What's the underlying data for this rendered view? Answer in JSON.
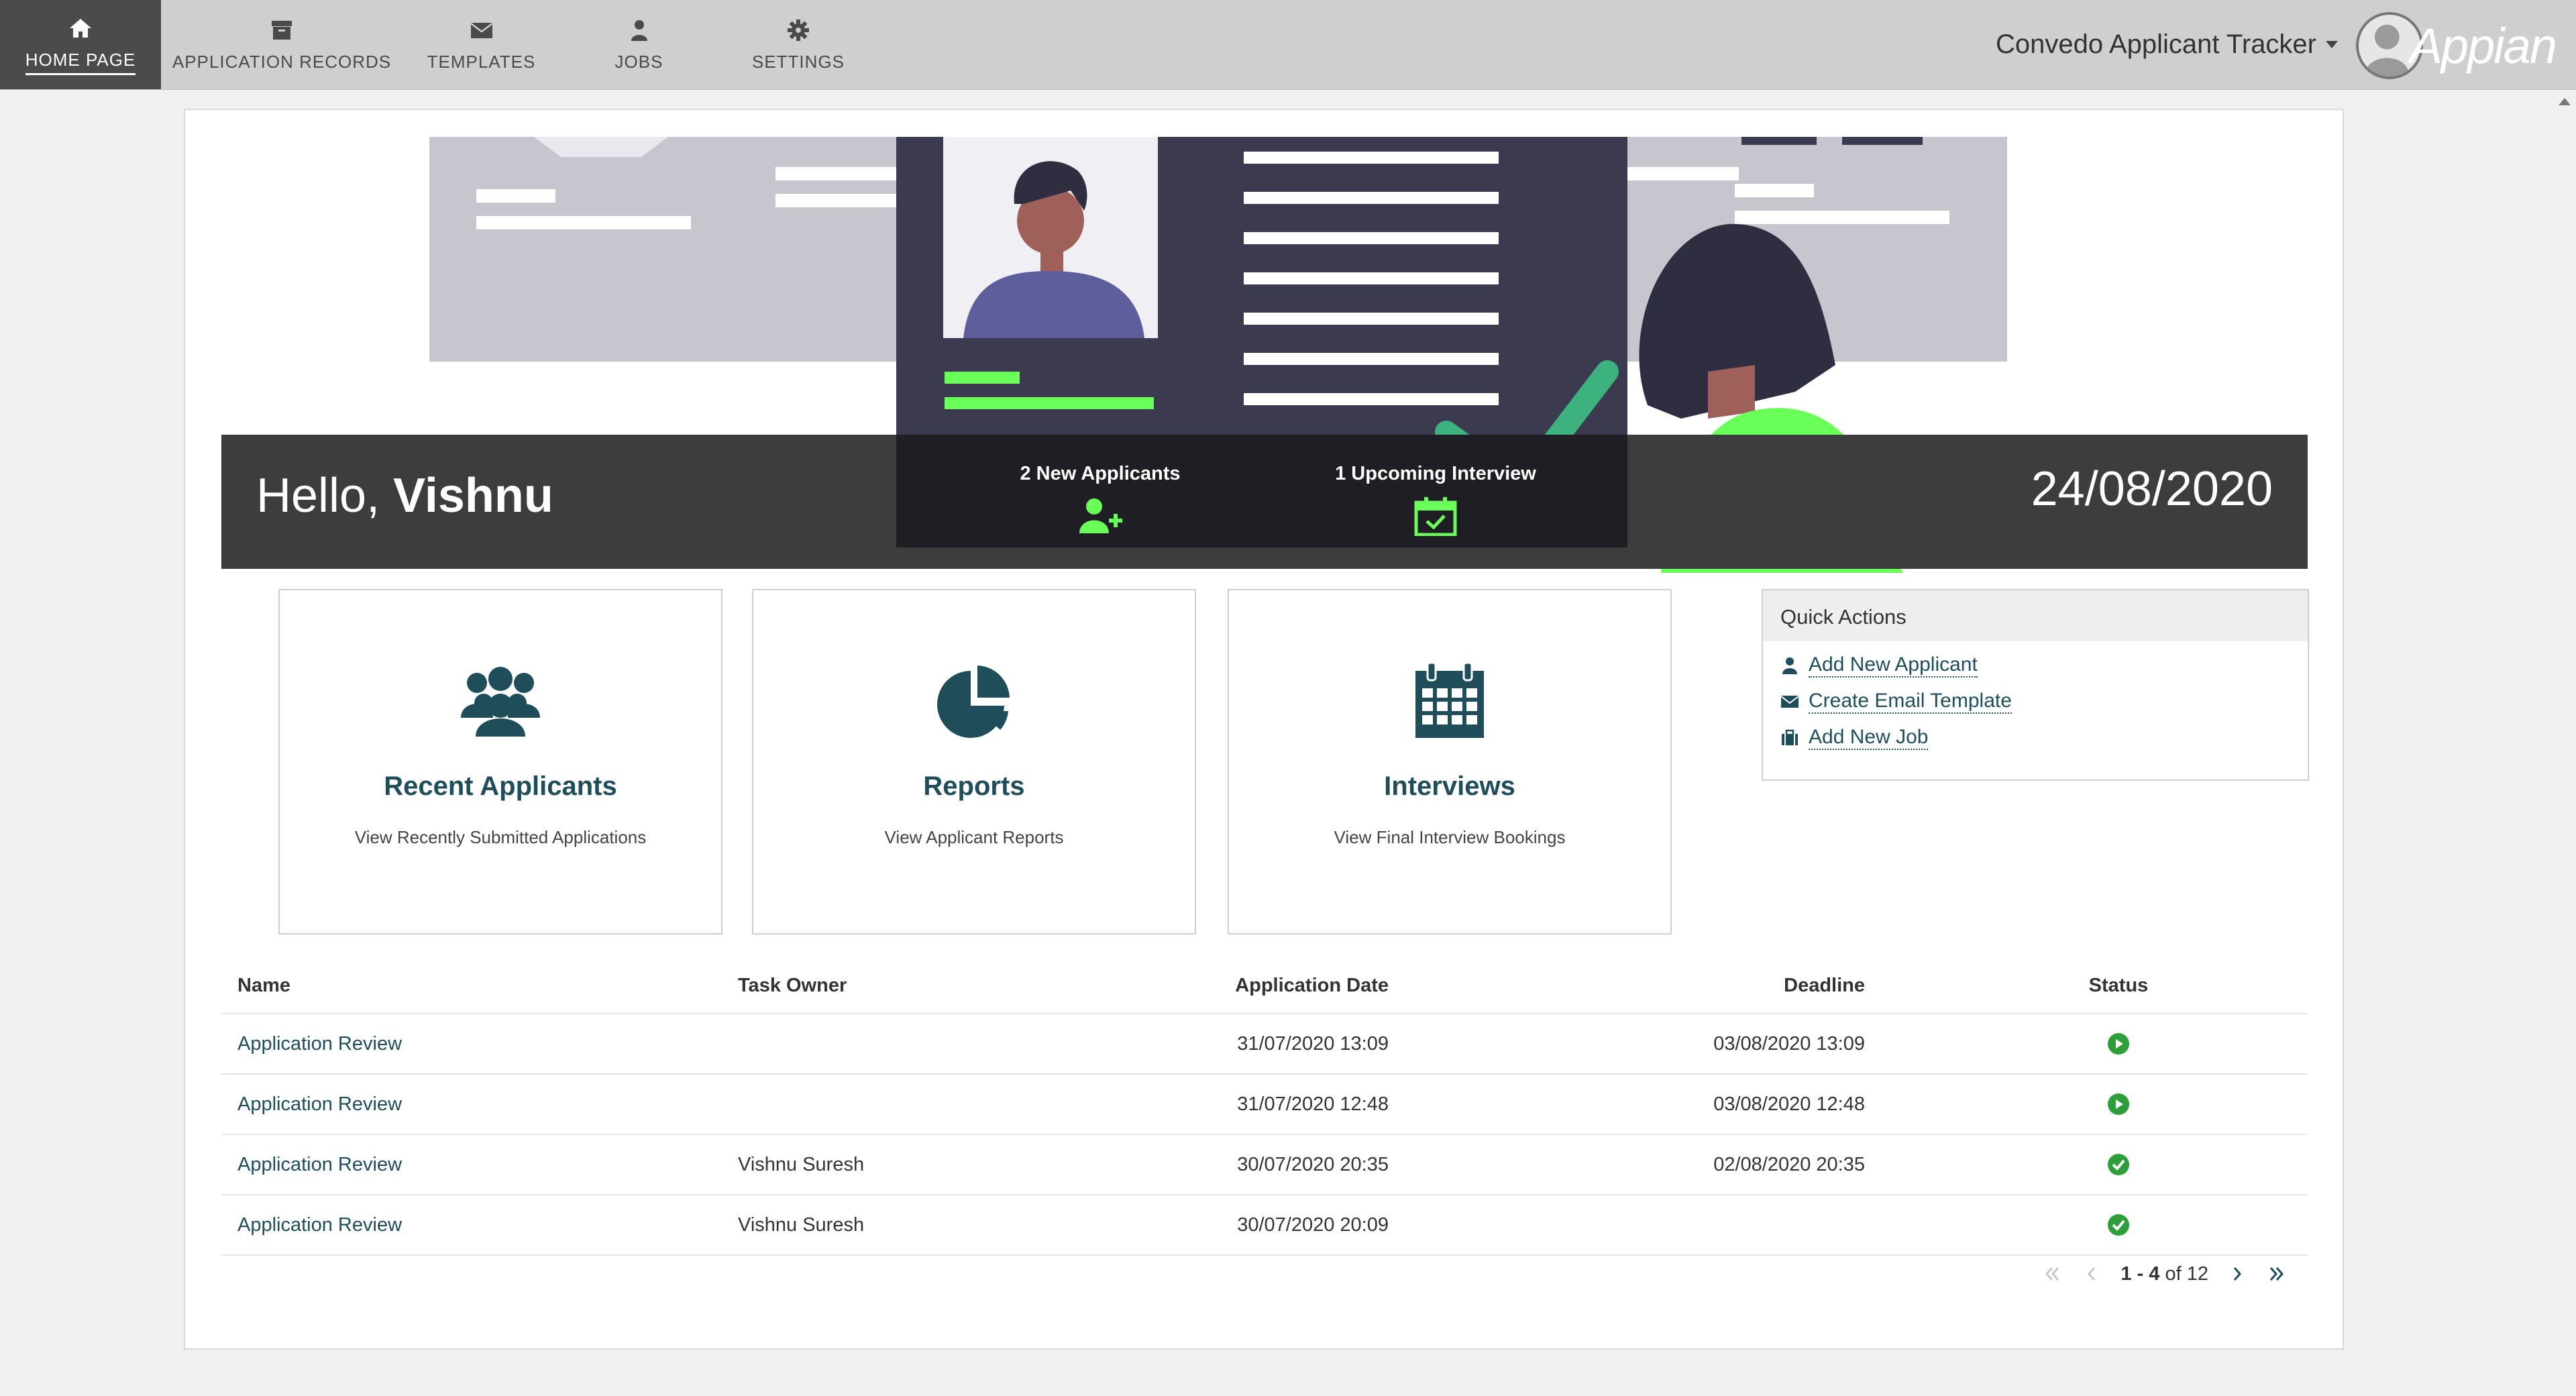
{
  "nav": {
    "items": [
      {
        "label": "HOME PAGE",
        "icon": "home-icon",
        "active": true
      },
      {
        "label": "APPLICATION RECORDS",
        "icon": "archive-icon"
      },
      {
        "label": "TEMPLATES",
        "icon": "envelope-icon"
      },
      {
        "label": "JOBS",
        "icon": "user-icon"
      },
      {
        "label": "SETTINGS",
        "icon": "gear-icon"
      }
    ],
    "app_title": "Convedo Applicant Tracker",
    "brand": "Appian"
  },
  "banner": {
    "greeting": "Hello,",
    "user": "Vishnu",
    "date": "24/08/2020",
    "stats": [
      {
        "label": "2 New Applicants",
        "icon": "user-plus-icon"
      },
      {
        "label": "1 Upcoming Interview",
        "icon": "calendar-check-icon"
      }
    ]
  },
  "tiles": [
    {
      "title": "Recent Applicants",
      "subtitle": "View Recently Submitted Applications",
      "icon": "users-icon"
    },
    {
      "title": "Reports",
      "subtitle": "View Applicant Reports",
      "icon": "pie-chart-icon"
    },
    {
      "title": "Interviews",
      "subtitle": "View Final Interview Bookings",
      "icon": "calendar-icon"
    }
  ],
  "quick_actions": {
    "title": "Quick Actions",
    "items": [
      {
        "label": "Add New Applicant",
        "icon": "user-icon"
      },
      {
        "label": "Create Email Template",
        "icon": "envelope-icon"
      },
      {
        "label": "Add New Job",
        "icon": "briefcase-icon"
      }
    ]
  },
  "table": {
    "headers": {
      "name": "Name",
      "owner": "Task Owner",
      "app_date": "Application Date",
      "deadline": "Deadline",
      "status": "Status"
    },
    "rows": [
      {
        "name": "Application Review",
        "owner": "",
        "app_date": "31/07/2020 13:09",
        "deadline": "03/08/2020 13:09",
        "status": "in-progress"
      },
      {
        "name": "Application Review",
        "owner": "",
        "app_date": "31/07/2020 12:48",
        "deadline": "03/08/2020 12:48",
        "status": "in-progress"
      },
      {
        "name": "Application Review",
        "owner": "Vishnu Suresh",
        "app_date": "30/07/2020 20:35",
        "deadline": "02/08/2020 20:35",
        "status": "completed"
      },
      {
        "name": "Application Review",
        "owner": "Vishnu Suresh",
        "app_date": "30/07/2020 20:09",
        "deadline": "",
        "status": "completed"
      }
    ]
  },
  "pager": {
    "range": "1 - 4",
    "of": "of 12"
  },
  "colors": {
    "accent": "#1f4e5a",
    "green": "#2e9e3a",
    "bright_green": "#6bff5a",
    "banner": "#3d3d3d"
  }
}
